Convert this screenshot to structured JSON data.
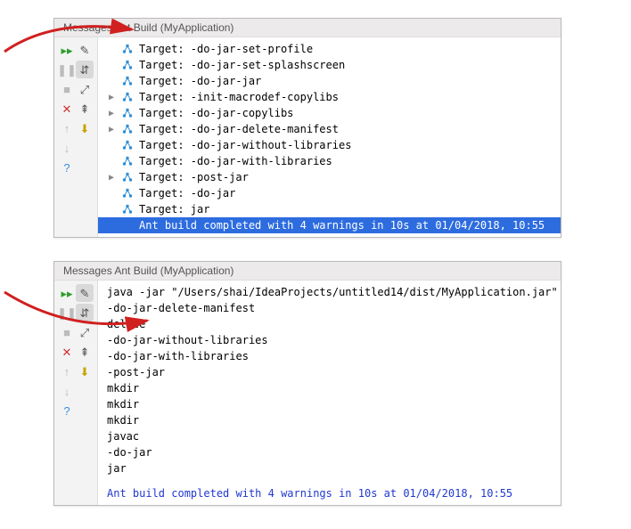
{
  "panel1": {
    "title": "Messages Ant Build (MyApplication)",
    "rows": [
      {
        "arrow": "",
        "icon": "hub",
        "text": "Target: -do-jar-set-profile"
      },
      {
        "arrow": "",
        "icon": "hub",
        "text": "Target: -do-jar-set-splashscreen"
      },
      {
        "arrow": "",
        "icon": "hub",
        "text": "Target: -do-jar-jar"
      },
      {
        "arrow": "▶",
        "icon": "hub",
        "text": "Target: -init-macrodef-copylibs"
      },
      {
        "arrow": "▶",
        "icon": "hub",
        "text": "Target: -do-jar-copylibs"
      },
      {
        "arrow": "▶",
        "icon": "hub",
        "text": "Target: -do-jar-delete-manifest"
      },
      {
        "arrow": "",
        "icon": "hub",
        "text": "Target: -do-jar-without-libraries"
      },
      {
        "arrow": "",
        "icon": "hub",
        "text": "Target: -do-jar-with-libraries"
      },
      {
        "arrow": "▶",
        "icon": "hub",
        "text": "Target: -post-jar"
      },
      {
        "arrow": "",
        "icon": "hub",
        "text": "Target: -do-jar"
      },
      {
        "arrow": "",
        "icon": "hub",
        "text": "Target: jar"
      },
      {
        "arrow": "",
        "icon": "",
        "text": "Ant build completed with 4 warnings in 10s at 01/04/2018, 10:55",
        "selected": true
      }
    ]
  },
  "panel2": {
    "title": "Messages Ant Build (MyApplication)",
    "lines": [
      "java -jar \"/Users/shai/IdeaProjects/untitled14/dist/MyApplication.jar\"",
      "-do-jar-delete-manifest",
      "delete",
      "-do-jar-without-libraries",
      "-do-jar-with-libraries",
      "-post-jar",
      "mkdir",
      "mkdir",
      "mkdir",
      "javac",
      "-do-jar",
      "jar"
    ],
    "completion": "Ant build completed with 4 warnings in 10s at 01/04/2018, 10:55"
  },
  "toolbar": {
    "tip_rerun": "▸▸",
    "tip_toggle_tree": "✎",
    "tip_pause": "❚❚",
    "tip_autoscroll": "⇵",
    "tip_stop": "■",
    "tip_expand": "⤢",
    "tip_close": "✕",
    "tip_collapse": "⇞",
    "tip_up": "↑",
    "tip_export": "⬇",
    "tip_down": "↓",
    "tip_help": "?"
  }
}
